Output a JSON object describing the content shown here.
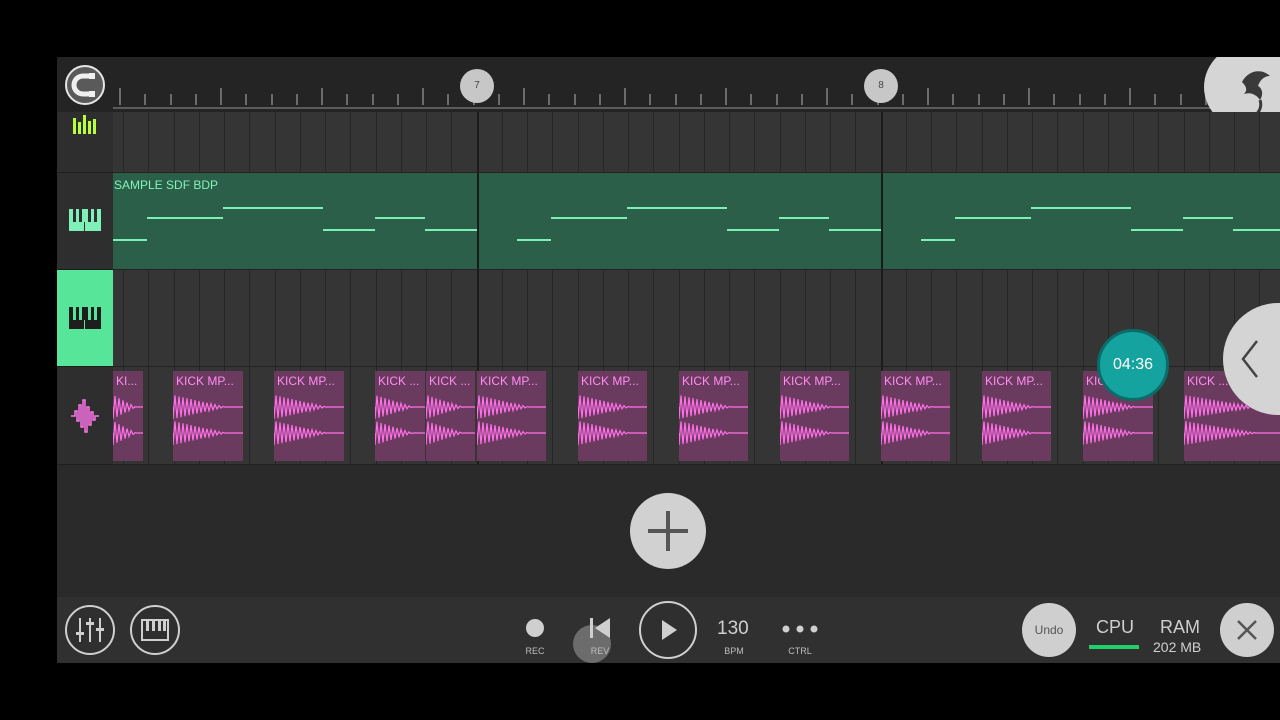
{
  "ruler": {
    "bar_markers": [
      "7",
      "8"
    ]
  },
  "tracks": {
    "pattern": {
      "label": "SAMPLE SDF BDP"
    },
    "audio": {
      "clips": [
        "KI...",
        "KICK MP...",
        "KICK MP...",
        "KICK ...",
        "KICK ...",
        "KICK MP...",
        "KICK MP...",
        "KICK MP...",
        "KICK MP...",
        "KICK MP...",
        "KICK MP...",
        "KICK",
        "KICK ..."
      ]
    }
  },
  "timer": "04:36",
  "toolbar": {
    "rec_label": "REC",
    "rev_label": "REV",
    "bpm_value": "130",
    "bpm_label": "BPM",
    "ctrl_label": "CTRL",
    "undo_label": "Undo",
    "cpu_label": "CPU",
    "ram_label": "RAM",
    "ram_value": "202 MB"
  },
  "colors": {
    "accent_green": "#57e59a",
    "pattern_note": "#79f0b5",
    "clip_pink": "#ff8df2",
    "timer_teal": "#15a3a0"
  }
}
